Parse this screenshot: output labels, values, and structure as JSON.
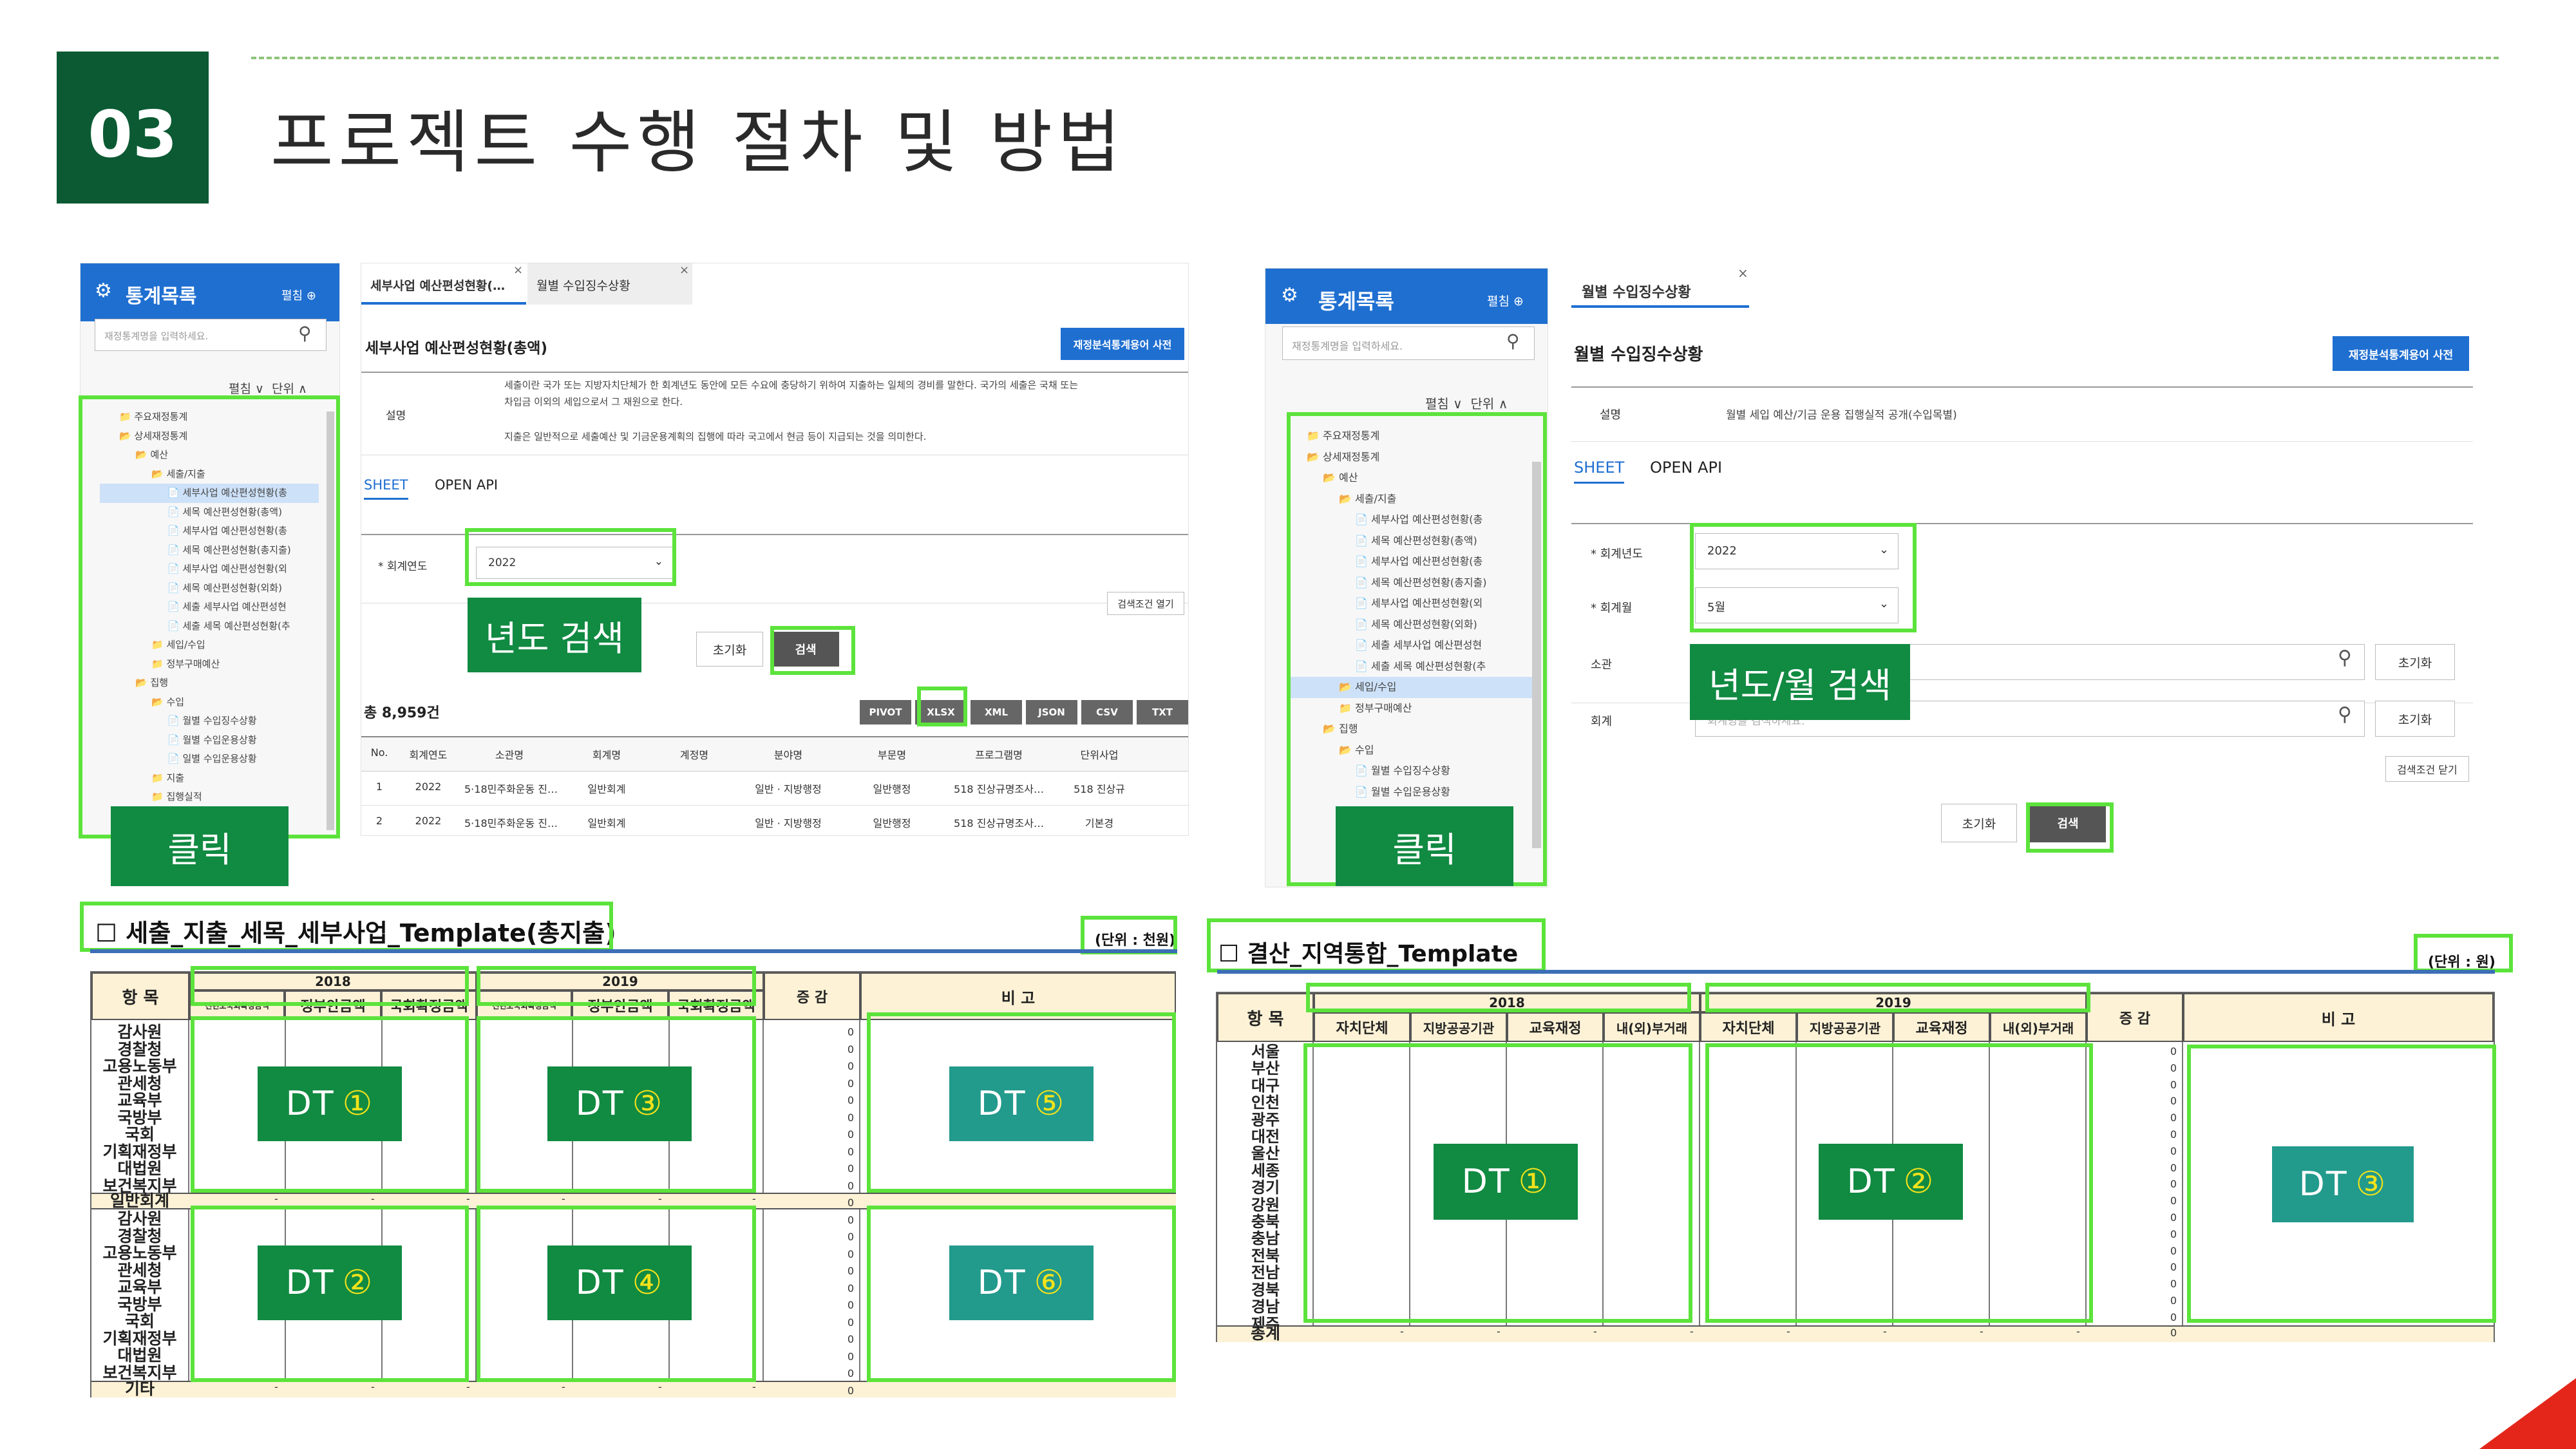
{
  "header": {
    "number": "03",
    "title": "프로젝트 수행 절차 및 방법"
  },
  "left_panel": {
    "sidebar": {
      "title": "통계목록",
      "expand_label": "펼침",
      "search_placeholder": "재정통계명을 입력하세요.",
      "tools": [
        "펼침",
        "단위"
      ],
      "tree_items": [
        "주요재정통계",
        "상세재정통계",
        "예산",
        "세출/지출",
        "세부사업 예산편성현황(총",
        "세목 예산편성현황(총액)",
        "세부사업 예산편성현황(총",
        "세목 예산편성현황(총지출)",
        "세부사업 예산편성현황(외",
        "세목 예산편성현황(외화)",
        "세출 세부사업 예산편성현",
        "세출 세목 예산편성현황(추",
        "세입/수입",
        "정부구매예산",
        "집행",
        "수입",
        "월별 수입징수상황",
        "월별 수입운용상황",
        "일별 수입운용상황",
        "지출",
        "집행실적"
      ]
    },
    "tabs": [
      "세부사업 예산편성현황(…",
      "월별 수입징수상황"
    ],
    "page_title": "세부사업 예산편성현황(총액)",
    "dict_button": "재정분석통계용어 사전",
    "desc_label": "설명",
    "desc_lines": [
      "세출이란 국가 또는 지방자치단체가 한 회계년도 동안에 모든 수요에 충당하기 위하여 지출하는 일체의 경비를 말한다. 국가의 세출은 국채 또는",
      "차입금 이외의 세입으로서 그 재원으로 한다.",
      "지출은 일반적으로 세출예산 및 기금운용계획의 집행에 따라 국고에서 현금 등이 지급되는 것을 의미한다."
    ],
    "view_tabs": [
      "SHEET",
      "OPEN API"
    ],
    "year_label": "* 회계연도",
    "year_value": "2022",
    "open_cond": "검색조건 열기",
    "reset_button": "초기화",
    "search_button": "검색",
    "total_count": "총 8,959건",
    "export_buttons": [
      "PIVOT",
      "XLSX",
      "XML",
      "JSON",
      "CSV",
      "TXT"
    ],
    "table_headers": [
      "No.",
      "회계연도",
      "소관명",
      "회계명",
      "계정명",
      "분야명",
      "부문명",
      "프로그램명",
      "단위사업"
    ],
    "table_rows": [
      [
        "1",
        "2022",
        "5·18민주화운동 진…",
        "일반회계",
        "",
        "일반 · 지방행정",
        "일반행정",
        "518 진상규명조사…",
        "518 진상규"
      ],
      [
        "2",
        "2022",
        "5·18민주화운동 진…",
        "일반회계",
        "",
        "일반 · 지방행정",
        "일반행정",
        "518 진상규명조사…",
        "기본경"
      ]
    ],
    "annot_year": "년도 검색",
    "annot_click": "클릭"
  },
  "right_panel": {
    "sidebar": {
      "title": "통계목록",
      "expand_label": "펼침",
      "search_placeholder": "재정통계명을 입력하세요.",
      "tools": [
        "펼침",
        "단위"
      ],
      "tree_items": [
        "주요재정통계",
        "상세재정통계",
        "예산",
        "세출/지출",
        "세부사업 예산편성현황(총",
        "세목 예산편성현황(총액)",
        "세부사업 예산편성현황(총",
        "세목 예산편성현황(총지출)",
        "세부사업 예산편성현황(외",
        "세목 예산편성현황(외화)",
        "세출 세부사업 예산편성현",
        "세출 세목 예산편성현황(추",
        "세입/수입",
        "정부구매예산",
        "집행",
        "수입",
        "월별 수입징수상황",
        "월별 수입운용상황"
      ]
    },
    "tab": "월별 수입징수상황",
    "page_title": "월별 수입징수상황",
    "dict_button": "재정분석통계용어 사전",
    "desc_label": "설명",
    "desc_text": "월별 세입 예산/기금 운용 집행실적 공개(수입목별)",
    "view_tabs": [
      "SHEET",
      "OPEN API"
    ],
    "year_label": "* 회계년도",
    "year_value": "2022",
    "month_label": "* 회계월",
    "month_value": "5월",
    "owner_label": "소관",
    "account_label": "회계",
    "account_placeholder": "회계명을 검색하세요.",
    "reset_small": "초기화",
    "close_cond": "검색조건 닫기",
    "reset_button": "초기화",
    "search_button": "검색",
    "annot_year_month": "년도/월 검색",
    "annot_click": "클릭"
  },
  "template_left": {
    "title": "☐ 세출_지출_세목_세부사업_Template(총지출)",
    "unit": "(단위 : 천원)",
    "item_header": "항 목",
    "years": [
      "2018",
      "2019"
    ],
    "sub_headers": [
      "전년도국회확정금액",
      "정부안금액",
      "국회확정금액"
    ],
    "change_header": "증 감",
    "note_header": "비 고",
    "agencies_a": [
      "감사원",
      "경찰청",
      "고용노동부",
      "관세청",
      "교육부",
      "국방부",
      "국회",
      "기획재정부",
      "대법원",
      "보건복지부"
    ],
    "subtotal_label": "일반회계",
    "agencies_b": [
      "감사원",
      "경찰청",
      "고용노동부",
      "관세청",
      "교육부",
      "국방부",
      "국회",
      "기획재정부",
      "대법원",
      "보건복지부"
    ],
    "other_label": "기타",
    "zero": "0",
    "dash": "-",
    "dt_blocks": [
      {
        "label": "DT",
        "num": "①"
      },
      {
        "label": "DT",
        "num": "②"
      },
      {
        "label": "DT",
        "num": "③"
      },
      {
        "label": "DT",
        "num": "④"
      },
      {
        "label": "DT",
        "num": "⑤"
      },
      {
        "label": "DT",
        "num": "⑥"
      }
    ]
  },
  "template_right": {
    "title": "☐ 결산_지역통합_Template",
    "unit": "(단위 : 원)",
    "item_header": "항 목",
    "years": [
      "2018",
      "2019"
    ],
    "sub_headers": [
      "자치단체",
      "지방공공기관",
      "교육재정",
      "내(외)부거래"
    ],
    "change_header": "증 감",
    "note_header": "비 고",
    "regions": [
      "서울",
      "부산",
      "대구",
      "인천",
      "광주",
      "대전",
      "울산",
      "세종",
      "경기",
      "강원",
      "충북",
      "충남",
      "전북",
      "전남",
      "경북",
      "경남",
      "제주"
    ],
    "total_label": "총계",
    "zero": "0",
    "dash": "-",
    "dt_blocks": [
      {
        "label": "DT",
        "num": "①"
      },
      {
        "label": "DT",
        "num": "②"
      },
      {
        "label": "DT",
        "num": "③"
      }
    ]
  }
}
